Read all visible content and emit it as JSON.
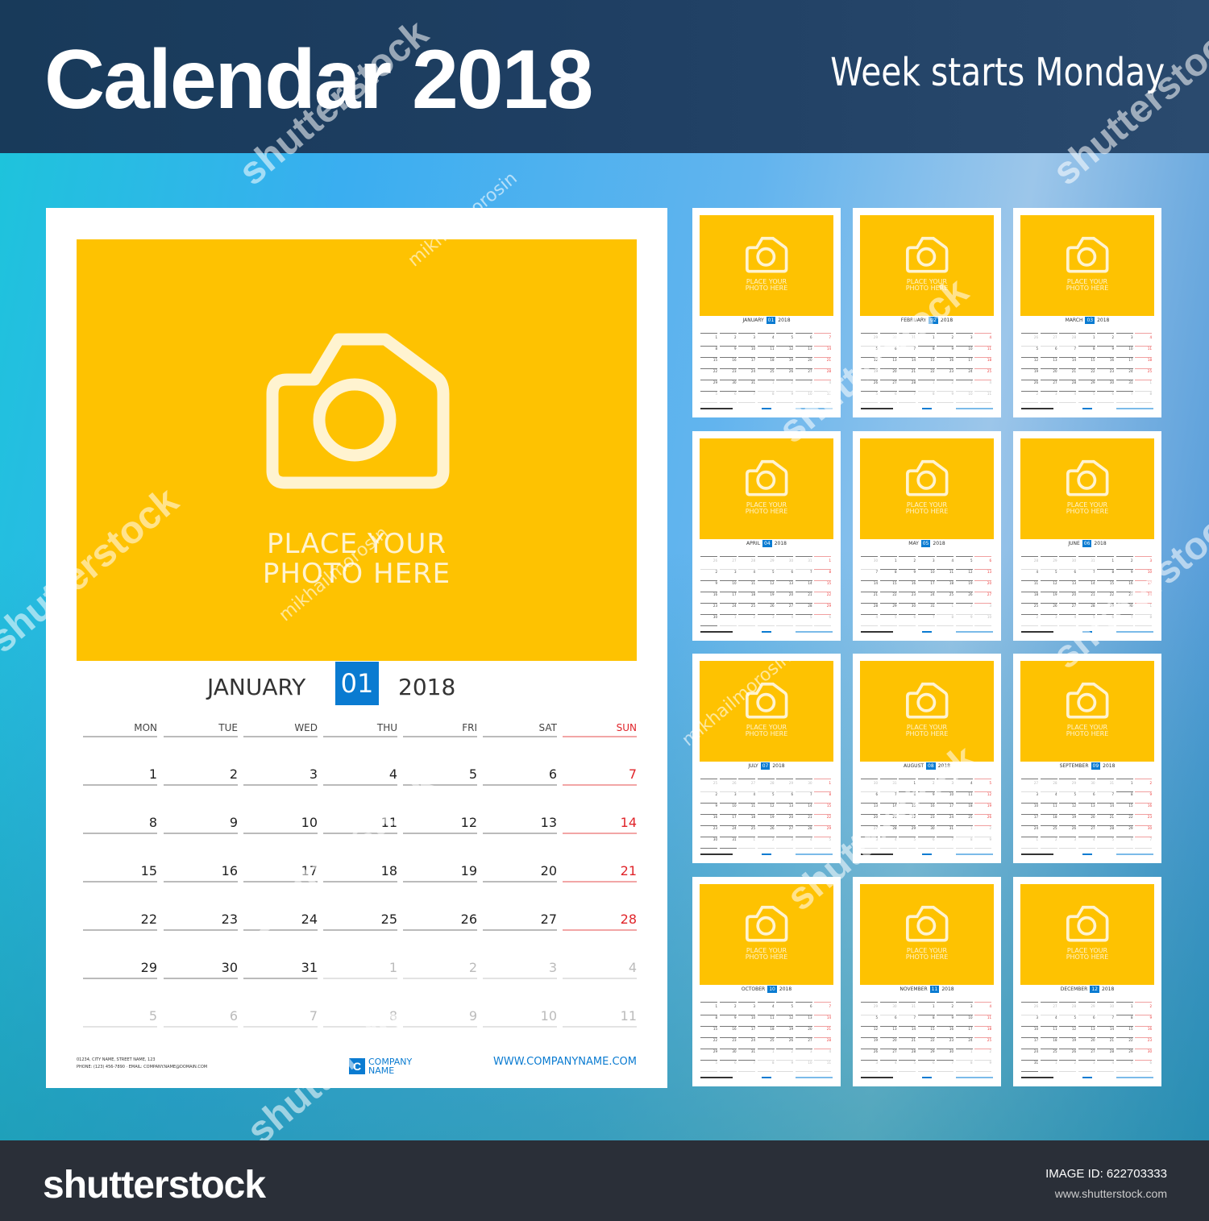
{
  "header": {
    "title": "Calendar 2018",
    "subtitle": "Week starts Monday"
  },
  "colors": {
    "accent": "#0a7bd1",
    "photo": "#fec201",
    "sunday": "#e0242a",
    "header": "#1c3c5e",
    "footer": "#2a2f38"
  },
  "main": {
    "photo_icon": "camera-icon",
    "photo_text_1": "PLACE YOUR",
    "photo_text_2": "PHOTO HERE",
    "month": "JANUARY",
    "month_num": "01",
    "year": "2018",
    "weekdays": [
      "MON",
      "TUE",
      "WED",
      "THU",
      "FRI",
      "SAT",
      "SUN"
    ],
    "weeks": [
      [
        {
          "d": "1"
        },
        {
          "d": "2"
        },
        {
          "d": "3"
        },
        {
          "d": "4"
        },
        {
          "d": "5"
        },
        {
          "d": "6"
        },
        {
          "d": "7"
        }
      ],
      [
        {
          "d": "8"
        },
        {
          "d": "9"
        },
        {
          "d": "10"
        },
        {
          "d": "11"
        },
        {
          "d": "12"
        },
        {
          "d": "13"
        },
        {
          "d": "14"
        }
      ],
      [
        {
          "d": "15"
        },
        {
          "d": "16"
        },
        {
          "d": "17"
        },
        {
          "d": "18"
        },
        {
          "d": "19"
        },
        {
          "d": "20"
        },
        {
          "d": "21"
        }
      ],
      [
        {
          "d": "22"
        },
        {
          "d": "23"
        },
        {
          "d": "24"
        },
        {
          "d": "25"
        },
        {
          "d": "26"
        },
        {
          "d": "27"
        },
        {
          "d": "28"
        }
      ],
      [
        {
          "d": "29"
        },
        {
          "d": "30"
        },
        {
          "d": "31"
        },
        {
          "d": "1",
          "muted": true
        },
        {
          "d": "2",
          "muted": true
        },
        {
          "d": "3",
          "muted": true
        },
        {
          "d": "4",
          "muted": true
        }
      ],
      [
        {
          "d": "5",
          "muted": true
        },
        {
          "d": "6",
          "muted": true
        },
        {
          "d": "7",
          "muted": true
        },
        {
          "d": "8",
          "muted": true
        },
        {
          "d": "9",
          "muted": true
        },
        {
          "d": "10",
          "muted": true
        },
        {
          "d": "11",
          "muted": true
        }
      ]
    ],
    "address_1": "01234, CITY NAME, STREET NAME, 123",
    "address_2": "PHONE: (123) 456-7890 · EMAIL: COMPANY.NAME@DOMAIN.COM",
    "logo_letter": "C",
    "company_1": "COMPANY",
    "company_2": "NAME",
    "url": "WWW.COMPANYNAME.COM"
  },
  "thumbnails": {
    "photo_text_1": "PLACE YOUR",
    "photo_text_2": "PHOTO HERE",
    "year": "2018",
    "months": [
      {
        "name": "JANUARY",
        "num": "01"
      },
      {
        "name": "FEBRUARY",
        "num": "02"
      },
      {
        "name": "MARCH",
        "num": "03"
      },
      {
        "name": "APRIL",
        "num": "04"
      },
      {
        "name": "MAY",
        "num": "05"
      },
      {
        "name": "JUNE",
        "num": "06"
      },
      {
        "name": "JULY",
        "num": "07"
      },
      {
        "name": "AUGUST",
        "num": "08"
      },
      {
        "name": "SEPTEMBER",
        "num": "09"
      },
      {
        "name": "OCTOBER",
        "num": "10"
      },
      {
        "name": "NOVEMBER",
        "num": "11"
      },
      {
        "name": "DECEMBER",
        "num": "12"
      }
    ]
  },
  "watermarks": {
    "brand": "shutterstock",
    "author": "mikhailmorosin"
  },
  "footer": {
    "brand": "shutterstock",
    "image_id": "IMAGE ID: 622703333",
    "site": "www.shutterstock.com"
  }
}
